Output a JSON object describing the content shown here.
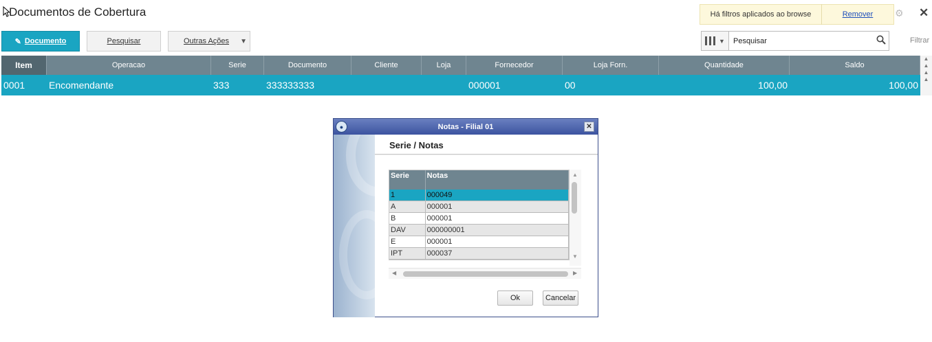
{
  "page": {
    "title": "Documentos de Cobertura"
  },
  "filter_notice": {
    "message": "Há filtros aplicados ao browse",
    "remove_label": "Remover"
  },
  "toolbar": {
    "documento_label": "Documento",
    "pesquisar_label": "Pesquisar",
    "outras_acoes_label": "Outras Ações"
  },
  "search": {
    "value": "Pesquisar",
    "filtrar_label": "Filtrar"
  },
  "grid": {
    "columns": [
      "Item",
      "Operacao",
      "Serie",
      "Documento",
      "Cliente",
      "Loja",
      "Fornecedor",
      "Loja Forn.",
      "Quantidade",
      "Saldo"
    ],
    "rows": [
      [
        "0001",
        "Encomendante",
        "333",
        "333333333",
        "",
        "",
        "000001",
        "00",
        "100,00",
        "100,00"
      ]
    ]
  },
  "dialog": {
    "title": "Notas - Filial 01",
    "heading": "Serie / Notas",
    "columns": [
      "Serie",
      "Notas"
    ],
    "rows": [
      [
        "1",
        "000049"
      ],
      [
        "A",
        "000001"
      ],
      [
        "B",
        "000001"
      ],
      [
        "DAV",
        "000000001"
      ],
      [
        "E",
        "000001"
      ],
      [
        "IPT",
        "000037"
      ]
    ],
    "ok_label": "Ok",
    "cancel_label": "Cancelar"
  },
  "icons": {
    "cursor": "mouse-pointer-icon",
    "gear": "gear-icon",
    "close": "close-icon",
    "pencil": "pencil-icon",
    "columns": "columns-icon",
    "search": "search-icon"
  },
  "colors": {
    "accent": "#1aa5c2",
    "grid_header": "#6f8590",
    "notice_bg": "#fdf8dc",
    "dialog_title": "#3c53a0"
  }
}
